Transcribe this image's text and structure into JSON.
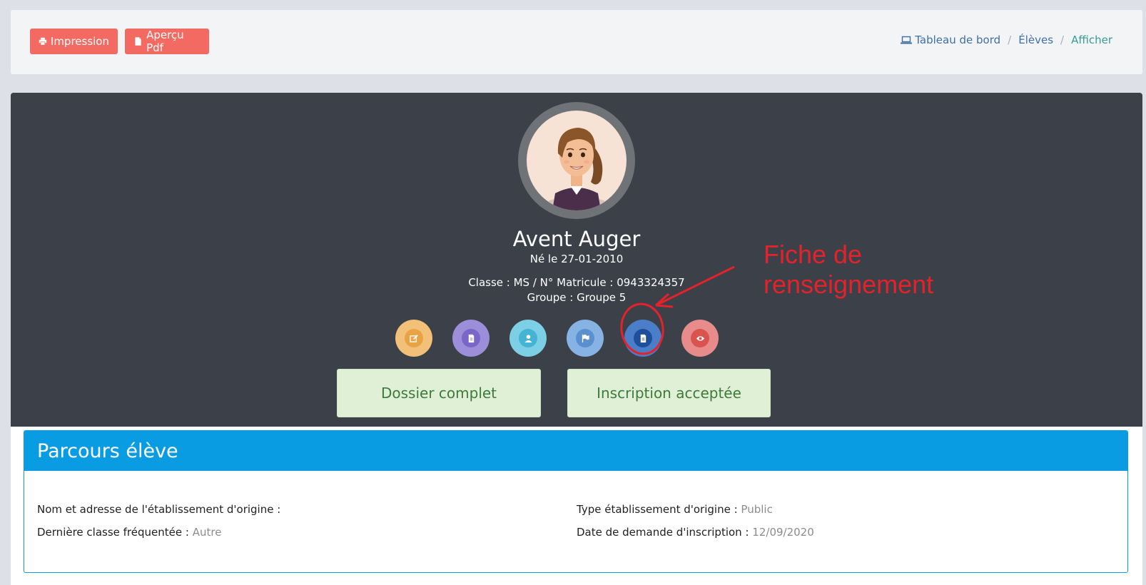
{
  "toolbar": {
    "print_label": "Impression",
    "pdf_label": "Aperçu Pdf",
    "button_color": "#f26a62"
  },
  "breadcrumb": {
    "items": [
      "Tableau de bord",
      "Élèves",
      "Afficher"
    ],
    "separator": "/"
  },
  "student": {
    "name": "Avent Auger",
    "born": "Né le 27-01-2010",
    "class_line": "Classe : MS / N° Matricule : 0943324357",
    "group_line": "Groupe : Groupe 5"
  },
  "actions": [
    {
      "icon": "edit-icon",
      "color": "#f1b35b"
    },
    {
      "icon": "document-icon",
      "color": "#8a7ed4"
    },
    {
      "icon": "user-icon",
      "color": "#5bc6e0"
    },
    {
      "icon": "flag-icon",
      "color": "#6fa8e6"
    },
    {
      "icon": "file-icon",
      "color": "#2e69b8"
    },
    {
      "icon": "eye-icon",
      "color": "#e46f71"
    }
  ],
  "status": {
    "dossier": "Dossier complet",
    "inscription": "Inscription acceptée"
  },
  "annotation": {
    "line1": "Fiche de",
    "line2": "renseignement",
    "color": "#e4222b"
  },
  "parcours": {
    "title": "Parcours élève",
    "origin_label": "Nom et adresse de l'établissement d'origine :",
    "origin_value": "",
    "last_class_label": "Dernière classe fréquentée :",
    "last_class_value": "Autre",
    "type_label": "Type établissement d'origine :",
    "type_value": "Public",
    "date_label": "Date de demande d'inscription :",
    "date_value": "12/09/2020"
  }
}
